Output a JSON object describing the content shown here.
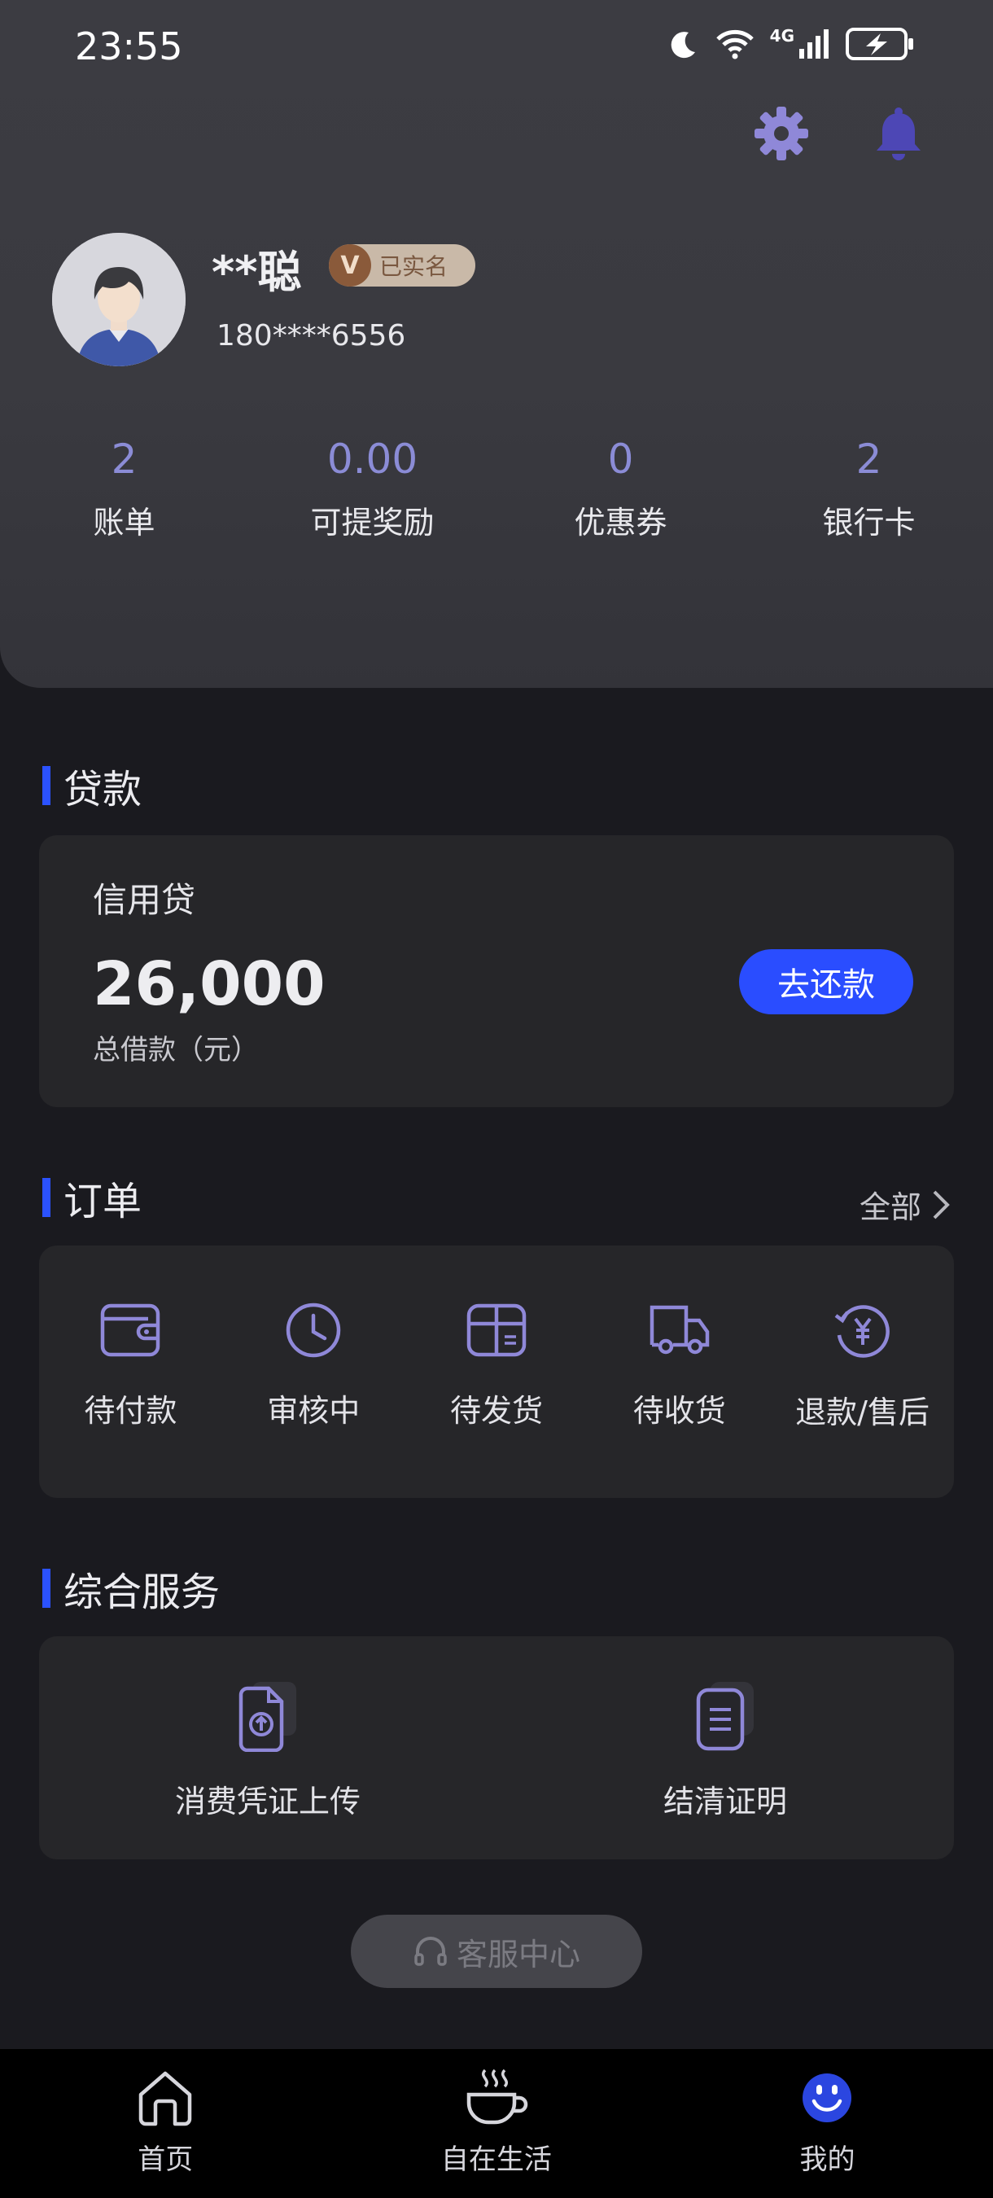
{
  "status_bar": {
    "time": "23:55",
    "network": "4G"
  },
  "header": {
    "settings_icon": "gear-icon",
    "notification_icon": "bell-icon",
    "user": {
      "name": "**聪",
      "verified_badge": "V",
      "verified_label": "已实名",
      "phone": "180****6556"
    },
    "stats": [
      {
        "value": "2",
        "label": "账单"
      },
      {
        "value": "0.00",
        "label": "可提奖励"
      },
      {
        "value": "0",
        "label": "优惠券"
      },
      {
        "value": "2",
        "label": "银行卡"
      }
    ]
  },
  "loan": {
    "section_title": "贷款",
    "product_name": "信用贷",
    "amount": "26,000",
    "amount_unit": "总借款（元）",
    "repay_button": "去还款"
  },
  "orders": {
    "section_title": "订单",
    "all_link": "全部",
    "items": [
      {
        "label": "待付款",
        "icon": "wallet-icon"
      },
      {
        "label": "审核中",
        "icon": "clock-icon"
      },
      {
        "label": "待发货",
        "icon": "package-icon"
      },
      {
        "label": "待收货",
        "icon": "truck-icon"
      },
      {
        "label": "退款/售后",
        "icon": "refund-icon"
      }
    ]
  },
  "services": {
    "section_title": "综合服务",
    "items": [
      {
        "label": "消费凭证上传",
        "icon": "upload-document-icon"
      },
      {
        "label": "结清证明",
        "icon": "certificate-document-icon"
      }
    ]
  },
  "customer_service": {
    "label": "客服中心",
    "icon": "headset-icon"
  },
  "bottom_nav": [
    {
      "label": "首页",
      "icon": "home-icon"
    },
    {
      "label": "自在生活",
      "icon": "coffee-cup-icon"
    },
    {
      "label": "我的",
      "icon": "smiley-icon",
      "active": true
    }
  ],
  "colors": {
    "accent": "#2b52ff",
    "stat_value": "#8b8cd6",
    "icon": "#8f88d8"
  }
}
